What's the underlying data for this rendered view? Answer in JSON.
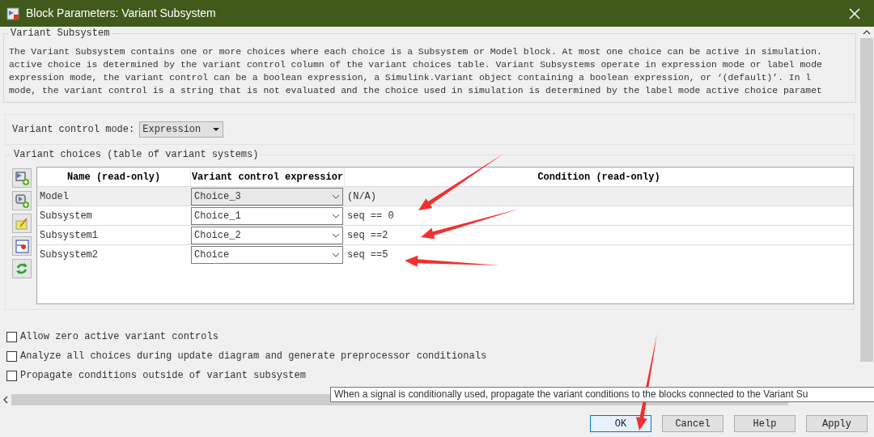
{
  "window": {
    "title": "Block Parameters: Variant Subsystem"
  },
  "section": {
    "title": "Variant Subsystem",
    "description_lines": [
      "The Variant Subsystem contains one or more choices where each choice is a Subsystem or Model block. At most one choice can be active in simulation.",
      "active choice is determined by the variant control column of the variant choices table. Variant Subsystems operate in expression mode or label mode",
      "expression mode, the variant control can be a boolean expression, a Simulink.Variant object containing a boolean expression, or ‘(default)’. In l",
      "mode, the variant control is a string that is not evaluated and the choice used in simulation is determined by the label mode active choice paramet"
    ]
  },
  "control_mode": {
    "label": "Variant control mode:",
    "value": "Expression"
  },
  "choices": {
    "title": "Variant choices (table of variant systems)",
    "columns": [
      "Name (read-only)",
      "Variant control expressior",
      "Condition (read-only)"
    ],
    "rows": [
      {
        "name": "Model",
        "expression": "Choice_3",
        "condition": "(N/A)",
        "selected": true
      },
      {
        "name": "Subsystem",
        "expression": "Choice_1",
        "condition": "seq == 0",
        "selected": false
      },
      {
        "name": "Subsystem1",
        "expression": "Choice_2",
        "condition": "seq ==2",
        "selected": false
      },
      {
        "name": "Subsystem2",
        "expression": "Choice",
        "condition": "seq ==5",
        "selected": false
      }
    ]
  },
  "checkboxes": [
    {
      "label": "Allow zero active variant controls",
      "checked": false
    },
    {
      "label": "Analyze all choices during update diagram and generate preprocessor conditionals",
      "checked": false
    },
    {
      "label": "Propagate conditions outside of variant subsystem",
      "checked": false
    }
  ],
  "tooltip": {
    "text": "When a signal is conditionally used, propagate the variant conditions to the blocks connected to the Variant Su"
  },
  "buttons": [
    {
      "label": "OK",
      "default": true
    },
    {
      "label": "Cancel",
      "default": false
    },
    {
      "label": "Help",
      "default": false
    },
    {
      "label": "Apply",
      "default": false
    }
  ]
}
